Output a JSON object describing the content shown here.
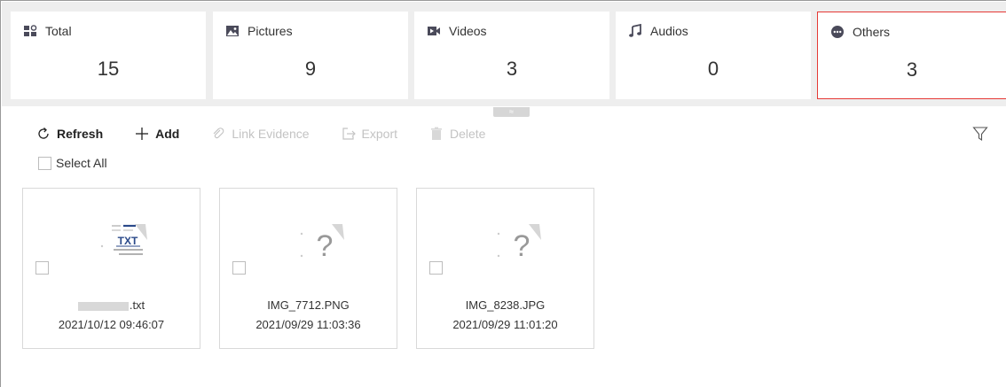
{
  "stats": [
    {
      "label": "Total",
      "value": "15",
      "icon": "total-icon"
    },
    {
      "label": "Pictures",
      "value": "9",
      "icon": "pictures-icon"
    },
    {
      "label": "Videos",
      "value": "3",
      "icon": "videos-icon"
    },
    {
      "label": "Audios",
      "value": "0",
      "icon": "audios-icon"
    },
    {
      "label": "Others",
      "value": "3",
      "icon": "others-icon"
    }
  ],
  "active_stat": "Others",
  "collapse_glyph": "≈",
  "toolbar": {
    "refresh_label": "Refresh",
    "add_label": "Add",
    "link_evidence_label": "Link Evidence",
    "export_label": "Export",
    "delete_label": "Delete"
  },
  "select_all_label": "Select All",
  "files": [
    {
      "name": ".txt",
      "name_redacted": true,
      "date": "2021/10/12 09:46:07",
      "thumb": "txt-file-icon",
      "thumb_text": "TXT"
    },
    {
      "name": "IMG_7712.PNG",
      "date": "2021/09/29 11:03:36",
      "thumb": "unknown-file-icon",
      "thumb_text": "?"
    },
    {
      "name": "IMG_8238.JPG",
      "date": "2021/09/29 11:01:20",
      "thumb": "unknown-file-icon",
      "thumb_text": "?"
    }
  ],
  "colors": {
    "active_border": "#e53935",
    "icon_dark": "#4a4a5a",
    "txt_blue": "#2b4a8a",
    "disabled_text": "#c3c3c3"
  }
}
